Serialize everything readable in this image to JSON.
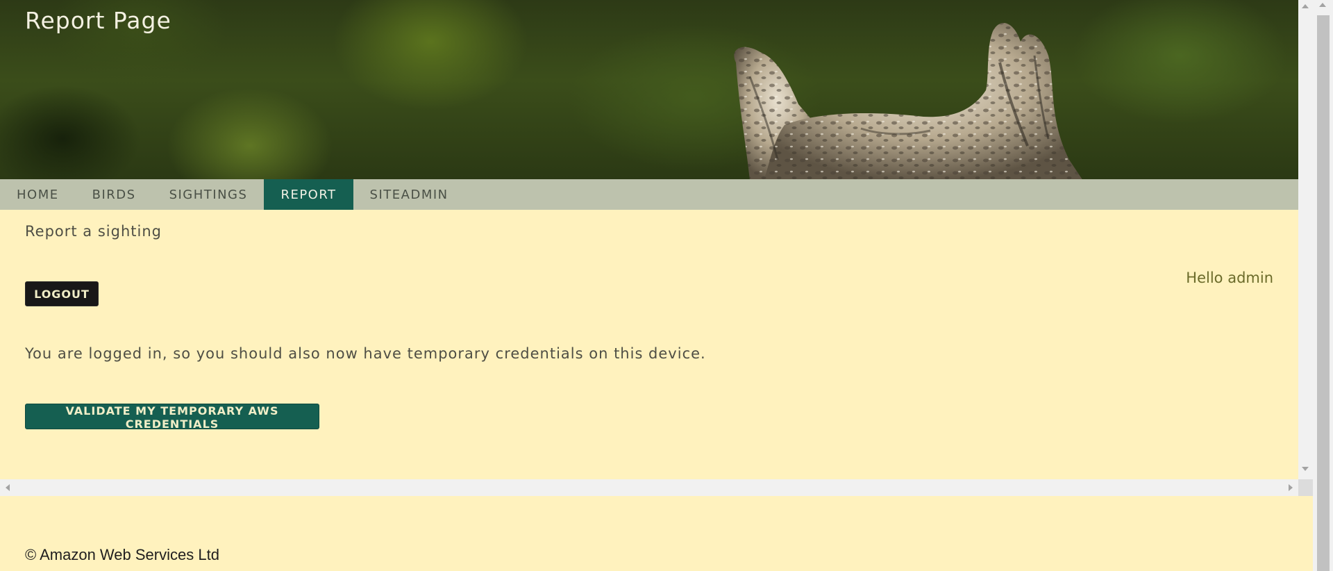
{
  "header": {
    "title": "Report Page"
  },
  "nav": {
    "items": [
      {
        "label": "HOME",
        "active": false
      },
      {
        "label": "BIRDS",
        "active": false
      },
      {
        "label": "SIGHTINGS",
        "active": false
      },
      {
        "label": "REPORT",
        "active": true
      },
      {
        "label": "SITEADMIN",
        "active": false
      }
    ]
  },
  "main": {
    "subtitle": "Report a sighting",
    "greeting": "Hello admin",
    "logout_label": "LOGOUT",
    "info_text": "You are logged in, so you should also now have temporary credentials on this device.",
    "validate_label": "VALIDATE MY TEMPORARY AWS CREDENTIALS"
  },
  "footer": {
    "copyright": "© Amazon Web Services Ltd"
  },
  "colors": {
    "page_background": "#fff2be",
    "nav_background": "#bdc2ad",
    "accent": "#155f51",
    "dark_button": "#181818",
    "greeting_text": "#6b6b2a"
  },
  "icons": {
    "hero_image": "owl-photo",
    "scroll_up": "scroll-up-arrow-icon",
    "scroll_down": "scroll-down-arrow-icon",
    "scroll_left": "scroll-left-arrow-icon",
    "scroll_right": "scroll-right-arrow-icon"
  }
}
